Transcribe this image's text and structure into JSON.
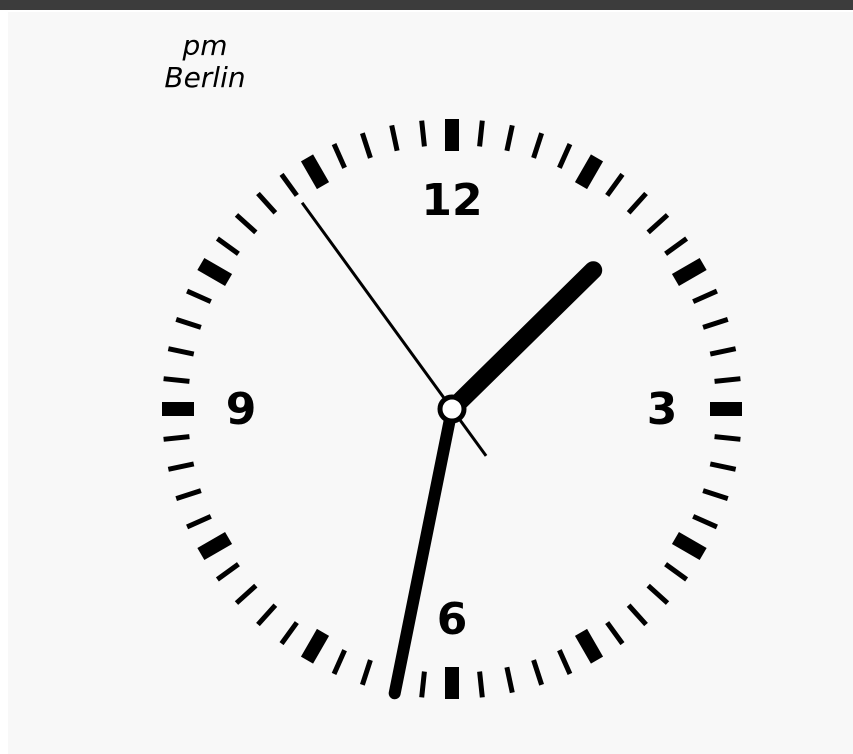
{
  "caption": {
    "period": "pm",
    "city": "Berlin"
  },
  "clock": {
    "numerals": [
      "12",
      "3",
      "6",
      "9"
    ],
    "time": {
      "hour": 1,
      "minute": 31,
      "second": 54
    },
    "colors": {
      "ink": "#000000",
      "face": "#f8f8f8",
      "border": "#3c3c3c"
    }
  }
}
